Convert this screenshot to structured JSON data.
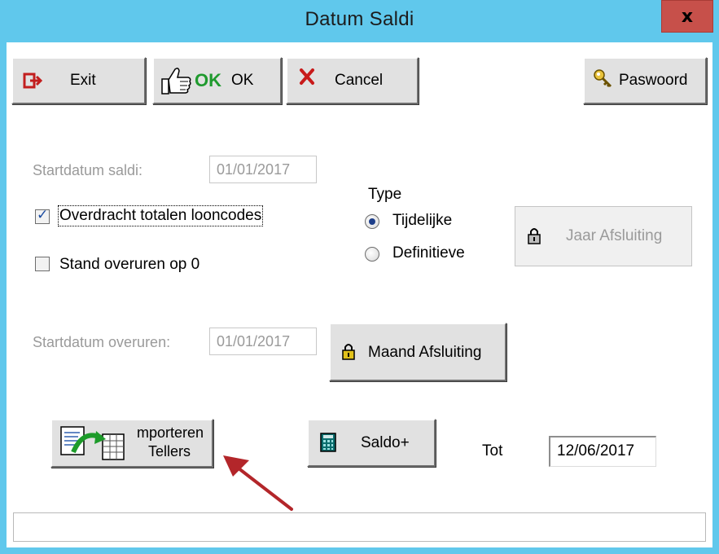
{
  "window": {
    "title": "Datum Saldi",
    "close_label": "x"
  },
  "toolbar": {
    "exit_label": "Exit",
    "ok_icon_text": "OK",
    "ok_label": "OK",
    "cancel_label": "Cancel",
    "password_label": "Paswoord"
  },
  "form": {
    "startdatum_saldi_label": "Startdatum saldi:",
    "startdatum_saldi_value": "01/01/2017",
    "overdracht_label": "Overdracht totalen looncodes",
    "overdracht_checked": true,
    "stand_overuren_label": "Stand overuren op 0",
    "stand_overuren_checked": false,
    "type_label": "Type",
    "type_options": [
      "Tijdelijke",
      "Definitieve"
    ],
    "type_selected": "Tijdelijke",
    "jaar_afsluiting_label": "Jaar Afsluiting",
    "startdatum_overuren_label": "Startdatum overuren:",
    "startdatum_overuren_value": "01/01/2017",
    "maand_afsluiting_label": "Maand Afsluiting",
    "importeren_line1": "mporteren",
    "importeren_line2": "Tellers",
    "saldo_label": "Saldo+",
    "tot_label": "Tot",
    "tot_value": "12/06/2017"
  },
  "colors": {
    "titlebar": "#60c8ec",
    "close": "#c7504a",
    "ok_green": "#1f9a2e",
    "arrow_red": "#b3262a"
  },
  "icons": [
    "exit-icon",
    "thumbs-up-icon",
    "cancel-x-icon",
    "key-icon",
    "lock-icon",
    "import-icon",
    "calculator-icon",
    "arrow-annotation"
  ]
}
